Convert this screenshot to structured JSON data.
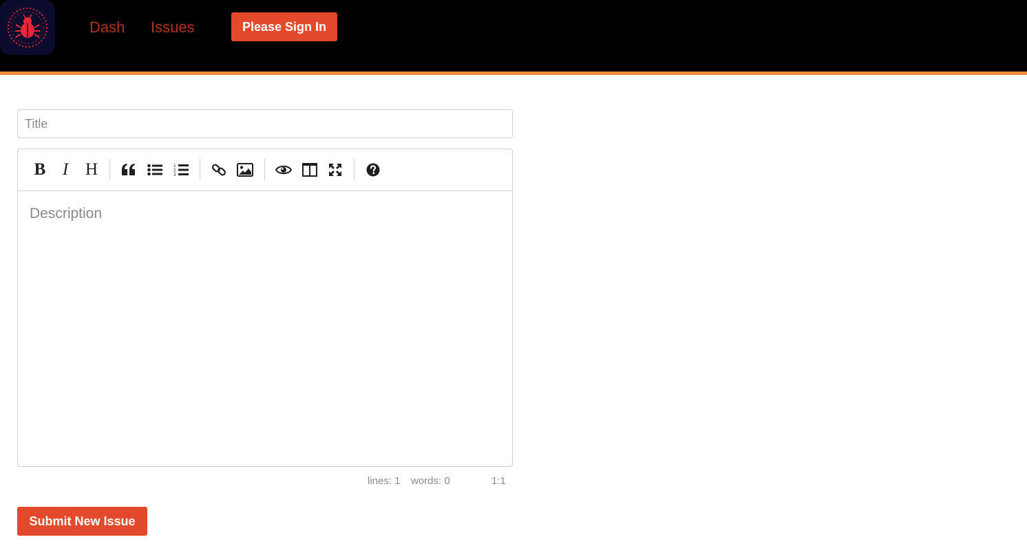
{
  "colors": {
    "navbar_bg": "#000000",
    "navbar_accent": "#f08a3c",
    "nav_link": "#b0341f",
    "primary_button": "#e34a2c",
    "logo_bg": "#0b0b2e",
    "logo_bug": "#e8283a"
  },
  "navbar": {
    "logo_icon": "bug-icon",
    "links": [
      {
        "label": "Dash"
      },
      {
        "label": "Issues"
      }
    ],
    "signin_label": "Please Sign In"
  },
  "form": {
    "title_placeholder": "Title",
    "description_placeholder": "Description",
    "submit_label": "Submit New Issue"
  },
  "editor": {
    "toolbar": [
      {
        "name": "bold",
        "icon": "bold-icon",
        "glyph": "B"
      },
      {
        "name": "italic",
        "icon": "italic-icon",
        "glyph": "I"
      },
      {
        "name": "heading",
        "icon": "heading-icon",
        "glyph": "H"
      },
      {
        "name": "quote",
        "icon": "quote-icon"
      },
      {
        "name": "unordered-list",
        "icon": "unordered-list-icon"
      },
      {
        "name": "ordered-list",
        "icon": "ordered-list-icon"
      },
      {
        "name": "link",
        "icon": "link-icon"
      },
      {
        "name": "image",
        "icon": "image-icon"
      },
      {
        "name": "preview",
        "icon": "eye-icon"
      },
      {
        "name": "side-by-side",
        "icon": "columns-icon"
      },
      {
        "name": "fullscreen",
        "icon": "fullscreen-icon"
      },
      {
        "name": "guide",
        "icon": "help-icon"
      }
    ],
    "status": {
      "lines": "lines: 1",
      "words": "words: 0",
      "cursor": "1:1"
    }
  }
}
